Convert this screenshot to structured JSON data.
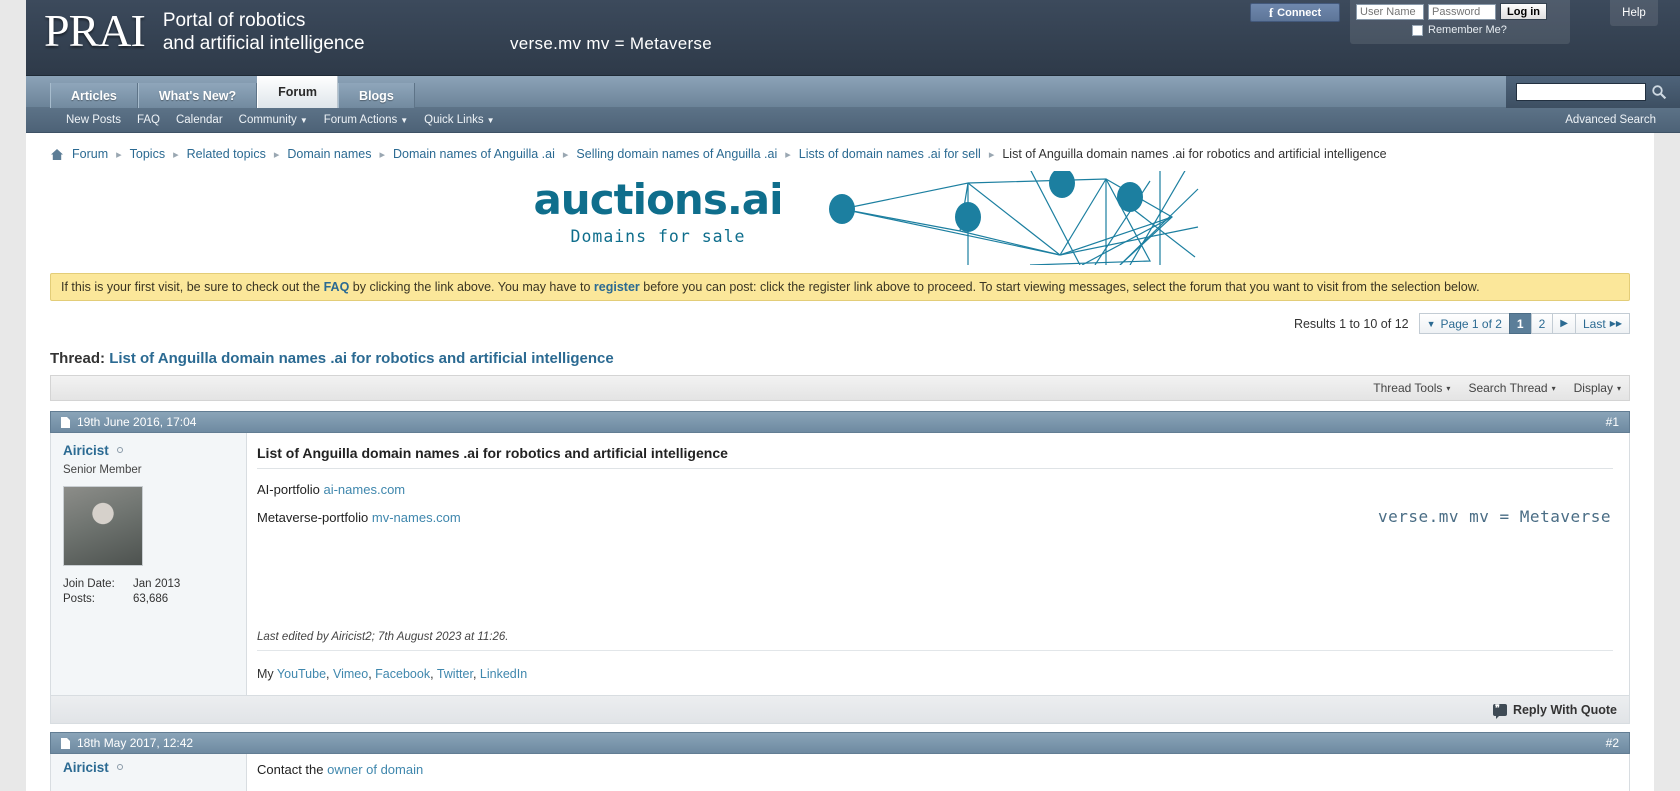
{
  "header": {
    "logo_mark": "PRAI",
    "tagline_line1": "Portal of robotics",
    "tagline_line2": "and artificial intelligence",
    "slogan": "verse.mv mv = Metaverse",
    "fb_connect_label": "Connect",
    "fb_icon": "facebook-icon",
    "username_placeholder": "User Name",
    "password_placeholder": "Password",
    "login_label": "Log in",
    "remember_label": "Remember Me?",
    "help_label": "Help"
  },
  "nav": {
    "tabs": [
      {
        "label": "Articles",
        "active": false
      },
      {
        "label": "What's New?",
        "active": false
      },
      {
        "label": "Forum",
        "active": true
      },
      {
        "label": "Blogs",
        "active": false
      }
    ],
    "search_placeholder": "",
    "search_value": "",
    "search_icon": "search-icon",
    "subnav": [
      {
        "label": "New Posts",
        "caret": false
      },
      {
        "label": "FAQ",
        "caret": false
      },
      {
        "label": "Calendar",
        "caret": false
      },
      {
        "label": "Community",
        "caret": true
      },
      {
        "label": "Forum Actions",
        "caret": true
      },
      {
        "label": "Quick Links",
        "caret": true
      }
    ],
    "advanced_search": "Advanced Search"
  },
  "breadcrumb": {
    "home_icon": "home-icon",
    "items": [
      "Forum",
      "Topics",
      "Related topics",
      "Domain names",
      "Domain names of Anguilla .ai",
      "Selling domain names of Anguilla .ai",
      "Lists of domain names .ai for sell"
    ],
    "current": "List of Anguilla domain names .ai for robotics and artificial intelligence",
    "separator": "▸"
  },
  "banner": {
    "title": "auctions.ai",
    "subtitle": "Domains for sale",
    "accent_color": "#0f6e8c"
  },
  "notice": {
    "part1": "If this is your first visit, be sure to check out the ",
    "link1": "FAQ",
    "part2": " by clicking the link above. You may have to ",
    "link2": "register",
    "part3": " before you can post: click the register link above to proceed. To start viewing messages, select the forum that you want to visit from the selection below."
  },
  "pager": {
    "results_text": "Results 1 to 10 of 12",
    "page_label": "Page 1 of 2",
    "page_caret": "▼",
    "pages": [
      "1",
      "2"
    ],
    "current_page": "1",
    "next_arrow": "▶",
    "last_label": "Last",
    "last_arrow": "▶▶"
  },
  "thread": {
    "prefix": "Thread:",
    "title": "List of Anguilla domain names .ai for robotics and artificial intelligence"
  },
  "toolbar": {
    "thread_tools": "Thread Tools",
    "search_thread": "Search Thread",
    "display": "Display",
    "caret": "▾"
  },
  "posts": [
    {
      "date": "19th June 2016, 17:04",
      "number": "#1",
      "user": {
        "name": "Airicist",
        "title": "Senior Member",
        "join_date_label": "Join Date:",
        "join_date": "Jan 2013",
        "posts_label": "Posts:",
        "posts": "63,686",
        "avatar": "user-avatar"
      },
      "title": "List of Anguilla domain names .ai for robotics and artificial intelligence",
      "lines": [
        {
          "text": "AI-portfolio ",
          "link": "ai-names.com"
        },
        {
          "text": "Metaverse-portfolio ",
          "link": "mv-names.com"
        }
      ],
      "right_note": "verse.mv mv = Metaverse",
      "last_edited": "Last edited by Airicist2; 7th August 2023 at 11:26.",
      "signature_prefix": "My ",
      "signature_links": [
        "YouTube",
        "Vimeo",
        "Facebook",
        "Twitter",
        "LinkedIn"
      ],
      "reply_label": "Reply With Quote",
      "reply_icon": "quote-icon"
    },
    {
      "date": "18th May 2017, 12:42",
      "number": "#2",
      "user": {
        "name": "Airicist"
      },
      "body_prefix": "Contact the ",
      "body_link": "owner of domain"
    }
  ]
}
